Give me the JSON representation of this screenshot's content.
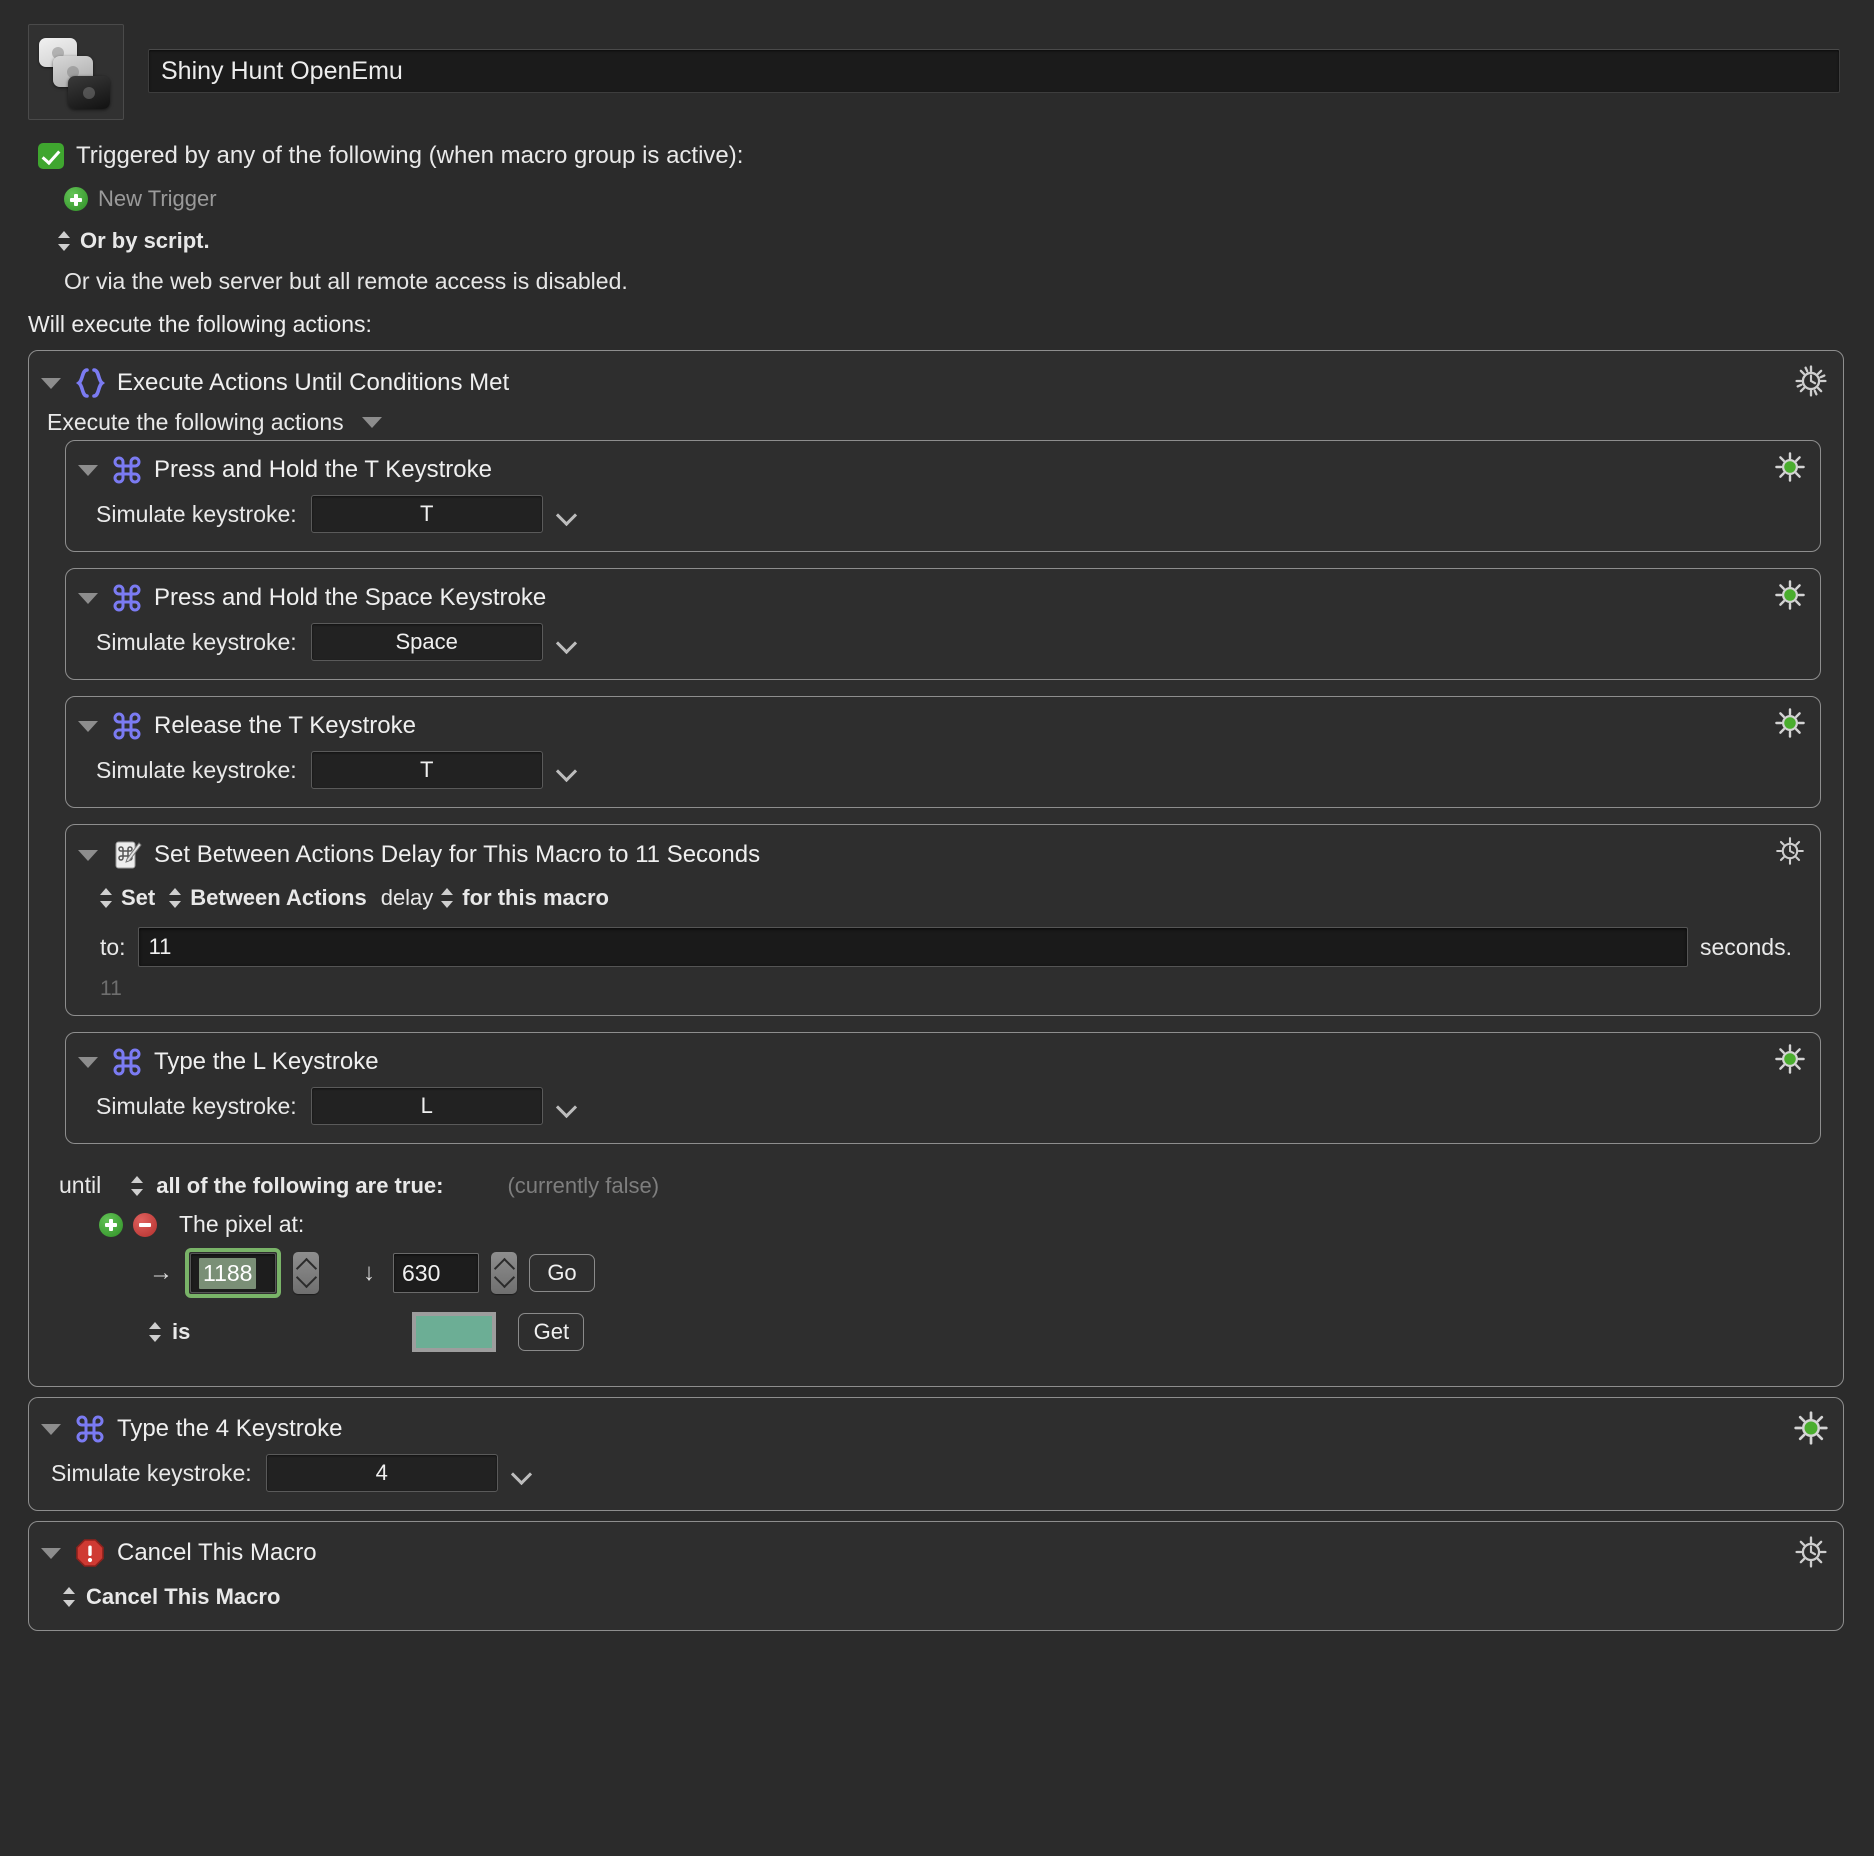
{
  "header": {
    "macro_icon_name": "keyboard-keys-stack-icon",
    "title": "Shiny Hunt OpenEmu"
  },
  "trigger": {
    "checkbox_checked": true,
    "label": "Triggered by any of the following (when macro group is active):",
    "new_trigger": "New Trigger",
    "or_by_script": "Or by script.",
    "web_server_note": "Or via the web server but all remote access is disabled.",
    "will_execute": "Will execute the following actions:"
  },
  "colors": {
    "accent_purple": "#7b7bf2",
    "green": "#3fa62f",
    "red": "#c23b38",
    "pixel_swatch": "#6cae95",
    "focus_ring": "#79b368"
  },
  "actions": [
    {
      "title": "Execute Actions Until Conditions Met",
      "icon": "braces-icon",
      "gear": "gear-clock-icon",
      "exec_label": "Execute the following actions",
      "children": [
        {
          "title": "Press and Hold the T Keystroke",
          "icon": "command-key-icon",
          "gear": "gear-green-icon",
          "ks_label": "Simulate keystroke:",
          "ks_value": "T"
        },
        {
          "title": "Press and Hold the Space Keystroke",
          "icon": "command-key-icon",
          "gear": "gear-green-icon",
          "ks_label": "Simulate keystroke:",
          "ks_value": "Space"
        },
        {
          "title": "Release the T Keystroke",
          "icon": "command-key-icon",
          "gear": "gear-green-icon",
          "ks_label": "Simulate keystroke:",
          "ks_value": "T"
        },
        {
          "title": "Set Between Actions Delay for This Macro to 11 Seconds",
          "icon": "card-pencil-icon",
          "gear": "gear-clock-icon",
          "sel_set": "Set",
          "sel_between": "Between Actions",
          "word_delay": "delay",
          "sel_scope": "for this macro",
          "to_label": "to:",
          "to_value": "11",
          "seconds_label": "seconds.",
          "preview_value": "11"
        },
        {
          "title": "Type the L Keystroke",
          "icon": "command-key-icon",
          "gear": "gear-green-icon",
          "ks_label": "Simulate keystroke:",
          "ks_value": "L"
        }
      ],
      "condition": {
        "until_word": "until",
        "match_mode": "all of the following are true:",
        "status": "(currently false)",
        "pixel_at_label": "The pixel at:",
        "x_arrow": "→",
        "x_value": "1188",
        "y_arrow": "↓",
        "y_value": "630",
        "go_button": "Go",
        "is_label": "is",
        "get_button": "Get",
        "swatch_color": "#6cae95"
      }
    },
    {
      "title": "Type the 4 Keystroke",
      "icon": "command-key-icon",
      "gear": "gear-green-icon",
      "ks_label": "Simulate keystroke:",
      "ks_value": "4"
    },
    {
      "title": "Cancel This Macro",
      "icon": "stop-sign-icon",
      "gear": "gear-clock-icon",
      "popup_label": "Cancel This Macro"
    }
  ]
}
